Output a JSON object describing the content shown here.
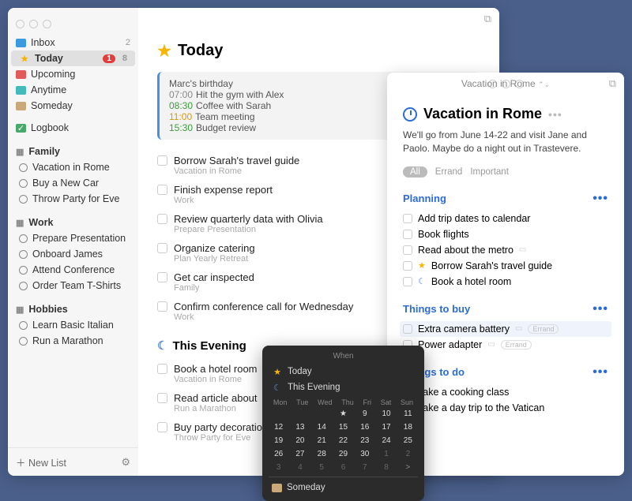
{
  "sidebar": {
    "smart": [
      {
        "icon": "inbox",
        "label": "Inbox",
        "count": "2"
      },
      {
        "icon": "star",
        "label": "Today",
        "badge": "1",
        "count": "8",
        "active": true
      },
      {
        "icon": "cal",
        "label": "Upcoming"
      },
      {
        "icon": "any",
        "label": "Anytime"
      },
      {
        "icon": "some",
        "label": "Someday"
      }
    ],
    "logbook": {
      "label": "Logbook"
    },
    "areas": [
      {
        "name": "Family",
        "projects": [
          "Vacation in Rome",
          "Buy a New Car",
          "Throw Party for Eve"
        ]
      },
      {
        "name": "Work",
        "projects": [
          "Prepare Presentation",
          "Onboard James",
          "Attend Conference",
          "Order Team T-Shirts"
        ]
      },
      {
        "name": "Hobbies",
        "projects": [
          "Learn Basic Italian",
          "Run a Marathon"
        ]
      }
    ],
    "new_list": "New List"
  },
  "main": {
    "title": "Today",
    "schedule": [
      {
        "time": "",
        "text": "Marc's birthday",
        "cls": ""
      },
      {
        "time": "07:00",
        "text": "Hit the gym with Alex",
        "cls": ""
      },
      {
        "time": "08:30",
        "text": "Coffee with Sarah",
        "cls": "g"
      },
      {
        "time": "11:00",
        "text": "Team meeting",
        "cls": "y"
      },
      {
        "time": "15:30",
        "text": "Budget review",
        "cls": "g"
      }
    ],
    "tasks": [
      {
        "title": "Borrow Sarah's travel guide",
        "sub": "Vacation in Rome"
      },
      {
        "title": "Finish expense report",
        "sub": "Work"
      },
      {
        "title": "Review quarterly data with Olivia",
        "sub": "Prepare Presentation"
      },
      {
        "title": "Organize catering",
        "sub": "Plan Yearly Retreat"
      },
      {
        "title": "Get car inspected",
        "sub": "Family"
      },
      {
        "title": "Confirm conference call for Wednesday",
        "sub": "Work"
      }
    ],
    "evening_title": "This Evening",
    "evening": [
      {
        "title": "Book a hotel room",
        "sub": "Vacation in Rome"
      },
      {
        "title": "Read article about",
        "sub": "Run a Marathon"
      },
      {
        "title": "Buy party decoratio",
        "sub": "Throw Party for Eve"
      }
    ]
  },
  "detail": {
    "window_title": "Vacation in Rome",
    "title": "Vacation in Rome",
    "desc": "We'll go from June 14-22 and visit Jane and Paolo. Maybe do a night out in Trastevere.",
    "tags": {
      "all": "All",
      "list": [
        "Errand",
        "Important"
      ]
    },
    "sections": [
      {
        "name": "Planning",
        "items": [
          {
            "t": "Add trip dates to calendar"
          },
          {
            "t": "Book flights"
          },
          {
            "t": "Read about the metro",
            "note": true
          },
          {
            "t": "Borrow Sarah's travel guide",
            "star": true
          },
          {
            "t": "Book a hotel room",
            "moon": true
          }
        ]
      },
      {
        "name": "Things to buy",
        "items": [
          {
            "t": "Extra camera battery",
            "note": true,
            "tag": "Errand",
            "sel": true
          },
          {
            "t": "Power adapter",
            "note": true,
            "tag": "Errand"
          }
        ]
      },
      {
        "name": "Things to do",
        "items": [
          {
            "t": "Take a cooking class"
          },
          {
            "t": "Take a day trip to the Vatican"
          }
        ]
      }
    ]
  },
  "popover": {
    "title": "When",
    "quick": [
      {
        "icon": "star",
        "label": "Today"
      },
      {
        "icon": "moon",
        "label": "This Evening"
      }
    ],
    "days": [
      "Mon",
      "Tue",
      "Wed",
      "Thu",
      "Fri",
      "Sat",
      "Sun"
    ],
    "grid": [
      [
        "",
        "",
        "",
        "★",
        "9",
        "10",
        "11"
      ],
      [
        "12",
        "13",
        "14",
        "15",
        "16",
        "17",
        "18"
      ],
      [
        "19",
        "20",
        "21",
        "22",
        "23",
        "24",
        "25"
      ],
      [
        "26",
        "27",
        "28",
        "29",
        "30",
        "1",
        "2"
      ],
      [
        "3",
        "4",
        "5",
        "6",
        "7",
        "8",
        ">"
      ]
    ],
    "someday": "Someday"
  }
}
